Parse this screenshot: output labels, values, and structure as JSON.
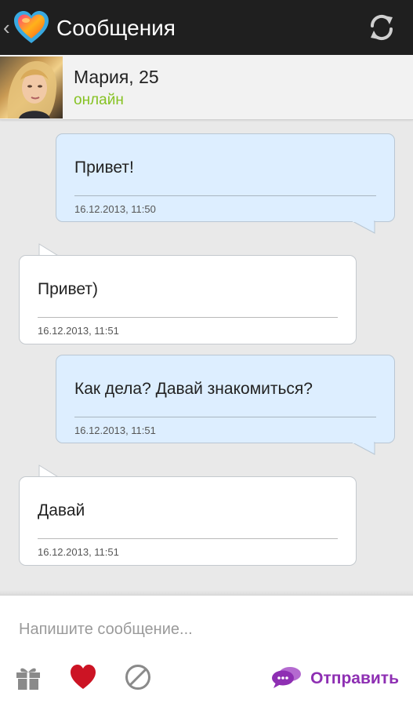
{
  "header": {
    "title": "Сообщения",
    "back_icon": "chevron-left-icon",
    "logo_icon": "heart-logo-icon",
    "refresh_icon": "refresh-icon"
  },
  "contact": {
    "name": "Мария, 25",
    "status": "онлайн",
    "status_color": "#86c222"
  },
  "messages": [
    {
      "direction": "out",
      "text": "Привет!",
      "time": "16.12.2013, 11:50"
    },
    {
      "direction": "in",
      "text": "Привет)",
      "time": "16.12.2013, 11:51"
    },
    {
      "direction": "out",
      "text": "Как дела? Давай знакомиться?",
      "time": "16.12.2013, 11:51"
    },
    {
      "direction": "in",
      "text": "Давай",
      "time": "16.12.2013, 11:51"
    }
  ],
  "composer": {
    "placeholder": "Напишите сообщение...",
    "value": "",
    "send_label": "Отправить",
    "actions": [
      "gift-icon",
      "heart-icon",
      "block-icon"
    ],
    "accent": "#8e2fb3"
  }
}
